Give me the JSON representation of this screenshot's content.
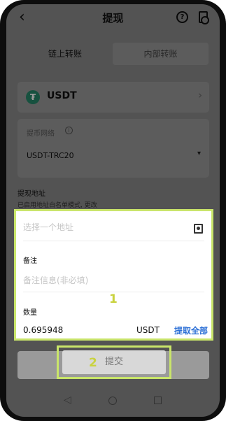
{
  "header": {
    "title": "提现",
    "back_icon": "chevron-left-icon",
    "help_label": "?"
  },
  "tabs": [
    {
      "label": "链上转账",
      "active": true
    },
    {
      "label": "内部转账",
      "active": false
    }
  ],
  "coin": {
    "name": "USDT",
    "logo": "₮",
    "brand_color": "#27886a"
  },
  "network": {
    "label": "提币网络",
    "info_icon": "ⓘ",
    "value": "USDT-TRC20"
  },
  "address": {
    "title": "提现地址",
    "hint": "已启用地址白名单模式, 更改",
    "placeholder": "选择一个地址"
  },
  "memo": {
    "label": "备注",
    "placeholder": "备注信息(非必填)"
  },
  "quantity": {
    "label": "数量",
    "value": "0.695948",
    "unit": "USDT",
    "withdraw_all": "提取全部",
    "link_color": "#2b6fd6"
  },
  "submit": {
    "label": "提交"
  },
  "annotations": {
    "step1": "1",
    "step2": "2",
    "highlight_color": "#c9e56a"
  }
}
